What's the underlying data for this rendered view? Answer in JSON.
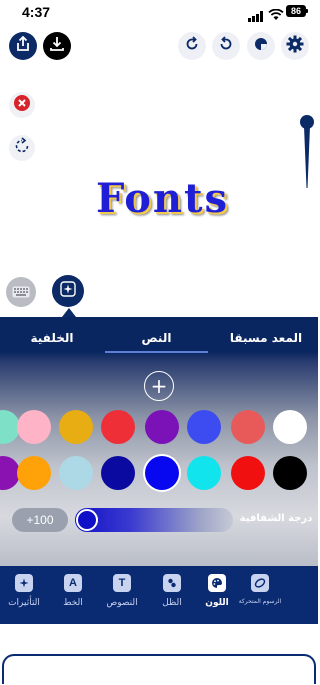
{
  "status": {
    "time": "4:37",
    "battery": "86"
  },
  "toolbar": {
    "left": [
      {
        "name": "share-icon"
      },
      {
        "name": "download-icon"
      }
    ],
    "right": [
      {
        "name": "redo-icon"
      },
      {
        "name": "undo-icon"
      },
      {
        "name": "shape-icon"
      },
      {
        "name": "gear-icon"
      }
    ]
  },
  "canvas": {
    "text": "Fonts",
    "text_color": "#1f1fd6"
  },
  "panel": {
    "tabs": [
      {
        "label": "المعد مسبقا",
        "selected": false
      },
      {
        "label": "النص",
        "selected": true
      },
      {
        "label": "الخلفية",
        "selected": false
      }
    ],
    "colors": {
      "row1": [
        "#7fe0c8",
        "#ffb3c6",
        "#e8ad12",
        "#ee2f38",
        "#7a12b8",
        "#3d4cf0",
        "#e85a5a",
        "#ffffff"
      ],
      "row2": [
        "#8a12b0",
        "#ffa108",
        "#add8e6",
        "#0a0aa0",
        "#0808f0",
        "#12e4ee",
        "#f01010",
        "#000000"
      ],
      "selected": "#0808f0"
    },
    "opacity": {
      "value_label": "+100",
      "value": 1.0,
      "label": "درجة الشفافية"
    }
  },
  "bottom_nav": [
    {
      "label": "الرسوم المتحركة",
      "icon": "animation-icon",
      "active": false
    },
    {
      "label": "اللون",
      "icon": "palette-icon",
      "active": true
    },
    {
      "label": "الظل",
      "icon": "shadow-icon",
      "active": false
    },
    {
      "label": "النصوص",
      "icon": "text-icon",
      "active": false
    },
    {
      "label": "الخط",
      "icon": "font-icon",
      "active": false
    },
    {
      "label": "التأثيرات",
      "icon": "effects-icon",
      "active": false
    }
  ]
}
